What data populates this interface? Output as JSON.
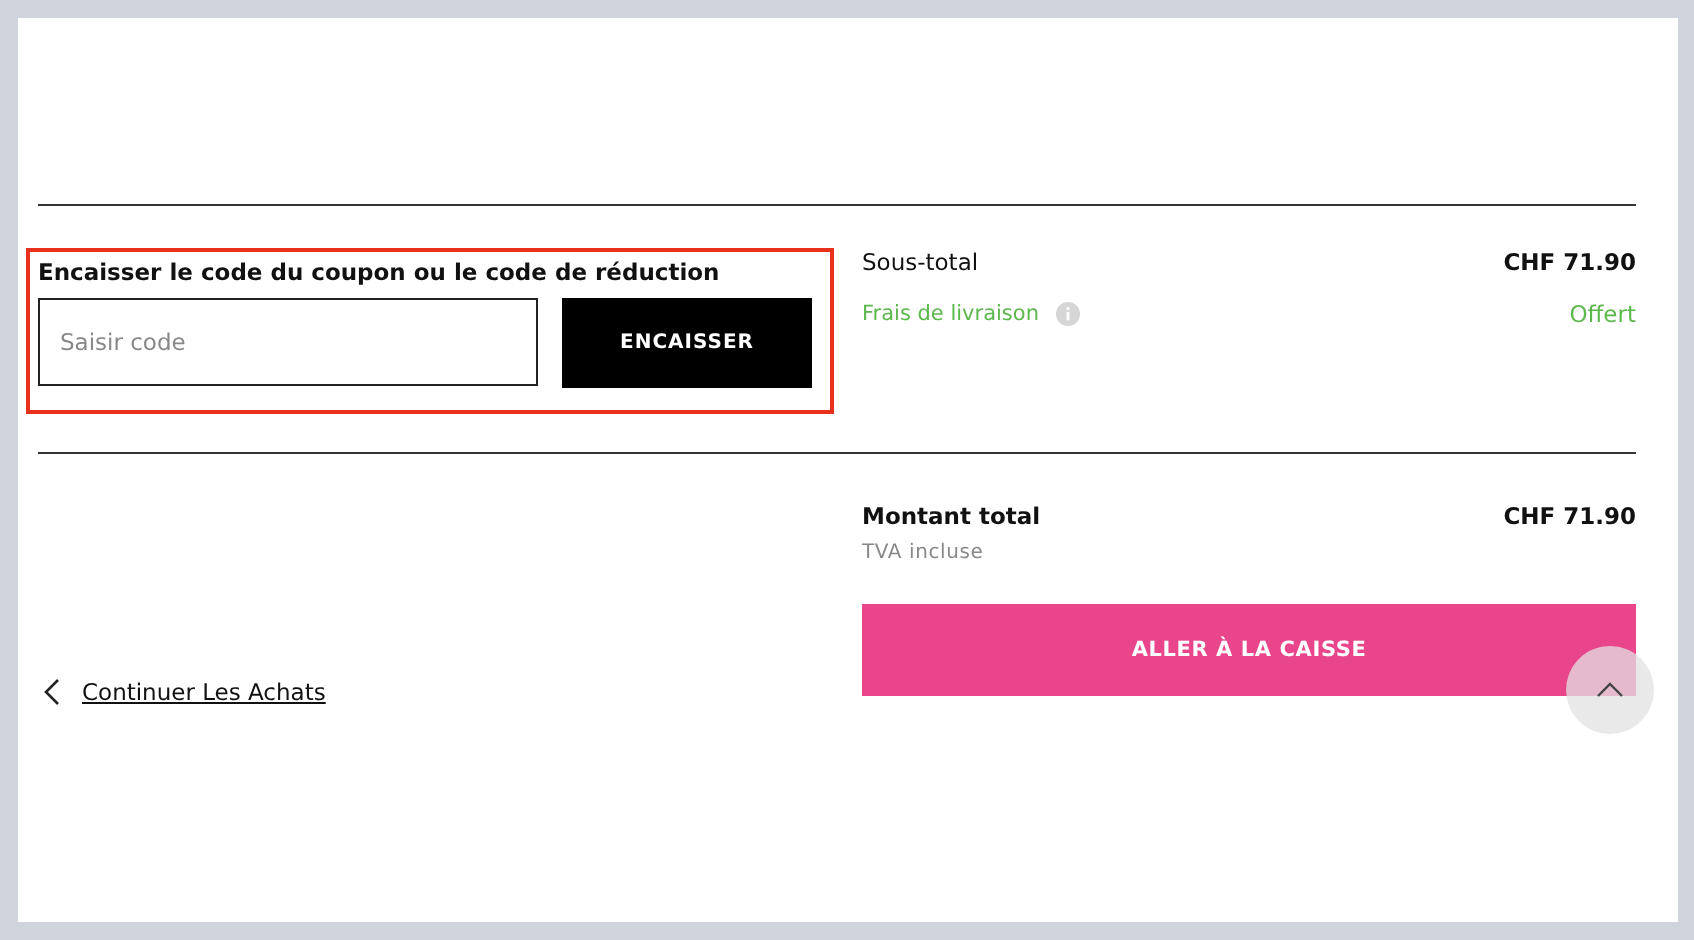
{
  "coupon": {
    "label": "Encaisser le code du coupon ou le code de réduction",
    "placeholder": "Saisir code",
    "button": "ENCAISSER"
  },
  "summary": {
    "subtotal_label": "Sous-total",
    "subtotal_value": "CHF 71.90",
    "shipping_label": "Frais de livraison",
    "shipping_value": "Offert",
    "total_label": "Montant total",
    "total_value": "CHF 71.90",
    "tax_note": "TVA incluse"
  },
  "checkout_button": "ALLER À LA CAISSE",
  "continue_link": "Continuer Les Achats"
}
